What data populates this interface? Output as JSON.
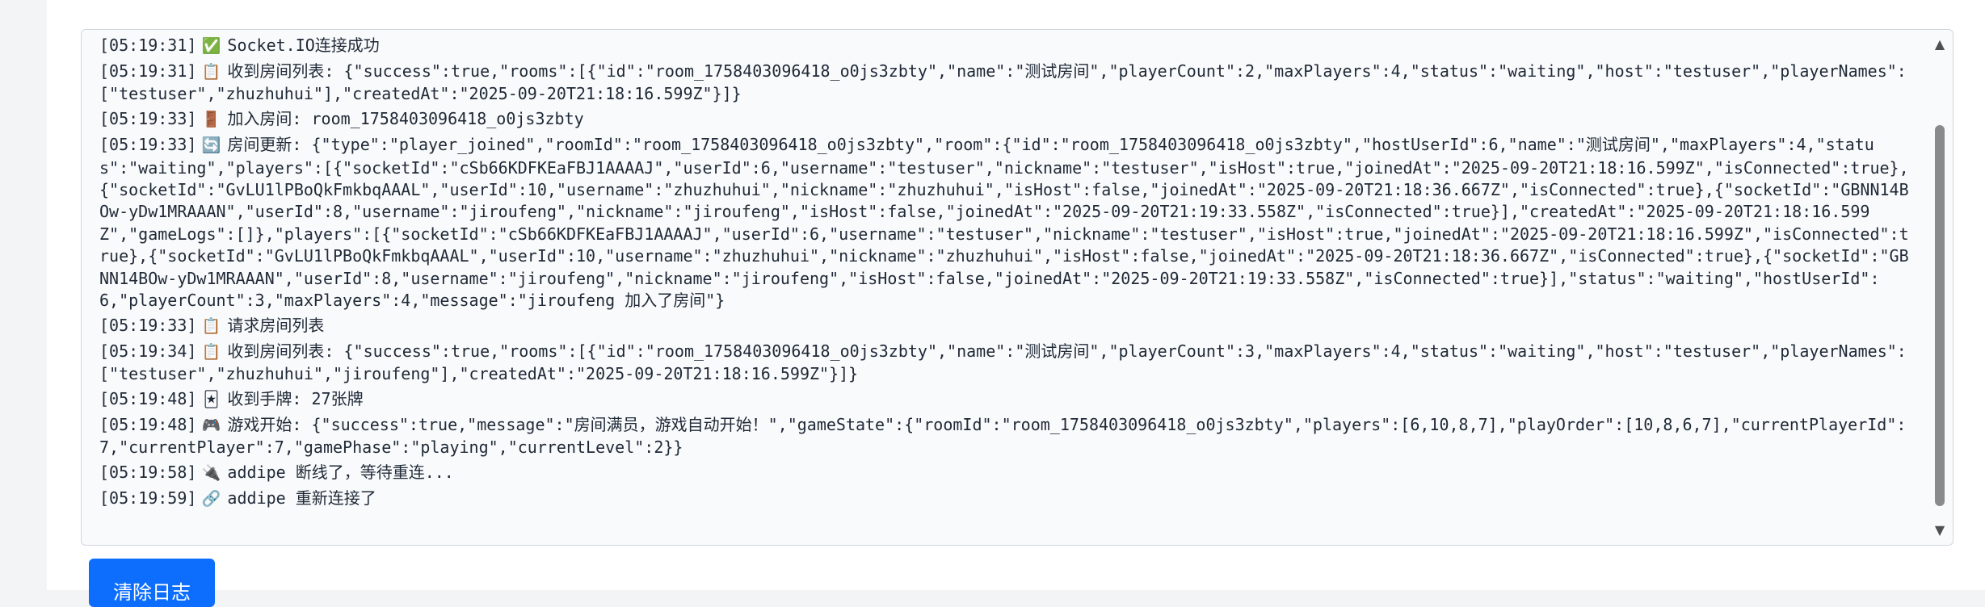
{
  "log": {
    "entries": [
      {
        "ts": "[05:19:31]",
        "icon": "✅",
        "icon_name": "check-icon",
        "text": "Socket.IO连接成功"
      },
      {
        "ts": "[05:19:31]",
        "icon": "📋",
        "icon_name": "clipboard-icon",
        "text": "收到房间列表: {\"success\":true,\"rooms\":[{\"id\":\"room_1758403096418_o0js3zbty\",\"name\":\"测试房间\",\"playerCount\":2,\"maxPlayers\":4,\"status\":\"waiting\",\"host\":\"testuser\",\"playerNames\":[\"testuser\",\"zhuzhuhui\"],\"createdAt\":\"2025-09-20T21:18:16.599Z\"}]}"
      },
      {
        "ts": "[05:19:33]",
        "icon": "🚪",
        "icon_name": "door-icon",
        "text": "加入房间: room_1758403096418_o0js3zbty"
      },
      {
        "ts": "[05:19:33]",
        "icon": "🔄",
        "icon_name": "refresh-icon",
        "text": "房间更新: {\"type\":\"player_joined\",\"roomId\":\"room_1758403096418_o0js3zbty\",\"room\":{\"id\":\"room_1758403096418_o0js3zbty\",\"hostUserId\":6,\"name\":\"测试房间\",\"maxPlayers\":4,\"status\":\"waiting\",\"players\":[{\"socketId\":\"cSb66KDFKEaFBJ1AAAAJ\",\"userId\":6,\"username\":\"testuser\",\"nickname\":\"testuser\",\"isHost\":true,\"joinedAt\":\"2025-09-20T21:18:16.599Z\",\"isConnected\":true},{\"socketId\":\"GvLU1lPBoQkFmkbqAAAL\",\"userId\":10,\"username\":\"zhuzhuhui\",\"nickname\":\"zhuzhuhui\",\"isHost\":false,\"joinedAt\":\"2025-09-20T21:18:36.667Z\",\"isConnected\":true},{\"socketId\":\"GBNN14BOw-yDw1MRAAAN\",\"userId\":8,\"username\":\"jiroufeng\",\"nickname\":\"jiroufeng\",\"isHost\":false,\"joinedAt\":\"2025-09-20T21:19:33.558Z\",\"isConnected\":true}],\"createdAt\":\"2025-09-20T21:18:16.599Z\",\"gameLogs\":[]},\"players\":[{\"socketId\":\"cSb66KDFKEaFBJ1AAAAJ\",\"userId\":6,\"username\":\"testuser\",\"nickname\":\"testuser\",\"isHost\":true,\"joinedAt\":\"2025-09-20T21:18:16.599Z\",\"isConnected\":true},{\"socketId\":\"GvLU1lPBoQkFmkbqAAAL\",\"userId\":10,\"username\":\"zhuzhuhui\",\"nickname\":\"zhuzhuhui\",\"isHost\":false,\"joinedAt\":\"2025-09-20T21:18:36.667Z\",\"isConnected\":true},{\"socketId\":\"GBNN14BOw-yDw1MRAAAN\",\"userId\":8,\"username\":\"jiroufeng\",\"nickname\":\"jiroufeng\",\"isHost\":false,\"joinedAt\":\"2025-09-20T21:19:33.558Z\",\"isConnected\":true}],\"status\":\"waiting\",\"hostUserId\":6,\"playerCount\":3,\"maxPlayers\":4,\"message\":\"jiroufeng 加入了房间\"}"
      },
      {
        "ts": "[05:19:33]",
        "icon": "📋",
        "icon_name": "clipboard-icon",
        "text": "请求房间列表"
      },
      {
        "ts": "[05:19:34]",
        "icon": "📋",
        "icon_name": "clipboard-icon",
        "text": "收到房间列表: {\"success\":true,\"rooms\":[{\"id\":\"room_1758403096418_o0js3zbty\",\"name\":\"测试房间\",\"playerCount\":3,\"maxPlayers\":4,\"status\":\"waiting\",\"host\":\"testuser\",\"playerNames\":[\"testuser\",\"zhuzhuhui\",\"jiroufeng\"],\"createdAt\":\"2025-09-20T21:18:16.599Z\"}]}"
      },
      {
        "ts": "[05:19:48]",
        "icon": "🃏",
        "icon_name": "cards-icon",
        "text": "收到手牌: 27张牌"
      },
      {
        "ts": "[05:19:48]",
        "icon": "🎮",
        "icon_name": "gamepad-icon",
        "text": "游戏开始: {\"success\":true,\"message\":\"房间满员，游戏自动开始！\",\"gameState\":{\"roomId\":\"room_1758403096418_o0js3zbty\",\"players\":[6,10,8,7],\"playOrder\":[10,8,6,7],\"currentPlayerId\":7,\"currentPlayer\":7,\"gamePhase\":\"playing\",\"currentLevel\":2}}"
      },
      {
        "ts": "[05:19:58]",
        "icon": "🔌",
        "icon_name": "plug-icon",
        "text": "addipe 断线了，等待重连..."
      },
      {
        "ts": "[05:19:59]",
        "icon": "🔗",
        "icon_name": "link-icon",
        "text": "addipe 重新连接了"
      }
    ]
  },
  "clear_button": {
    "label": "清除日志"
  }
}
